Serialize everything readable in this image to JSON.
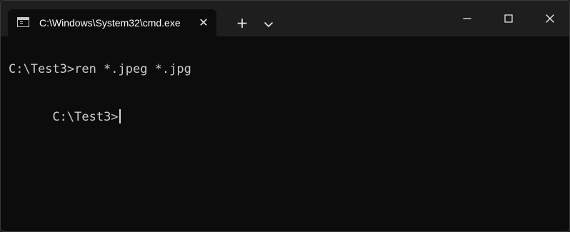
{
  "window": {
    "tab_title": "C:\\Windows\\System32\\cmd.exe",
    "tab_icon": "command-prompt-icon",
    "tab_close_icon": "close-icon",
    "new_tab_icon": "plus-icon",
    "dropdown_icon": "chevron-down-icon",
    "minimize_icon": "minimize-icon",
    "maximize_icon": "maximize-icon",
    "close_icon": "close-icon"
  },
  "console": {
    "lines": [
      "C:\\Test3>ren *.jpeg *.jpg",
      "C:\\Test3>"
    ]
  },
  "colors": {
    "title_bar": "#1e1e1e",
    "console_background": "#0c0c0c",
    "console_text": "#cccccc",
    "tab_text": "#ffffff"
  }
}
